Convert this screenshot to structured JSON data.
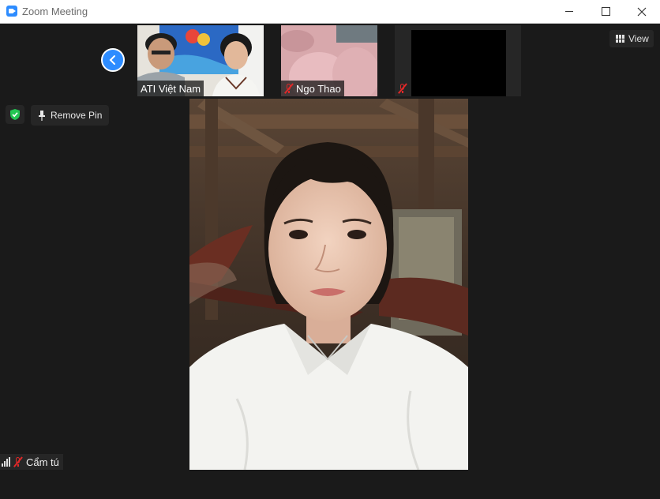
{
  "window": {
    "title": "Zoom Meeting"
  },
  "toolbar": {
    "view_label": "View",
    "remove_pin_label": "Remove Pin"
  },
  "thumbnails": [
    {
      "name": "ATI Việt Nam",
      "muted": false
    },
    {
      "name": "Ngo Thao",
      "muted": true
    },
    {
      "name": "",
      "muted": true
    }
  ],
  "self": {
    "name": "Cẩm tú",
    "muted": true
  },
  "colors": {
    "accent": "#2d8cff",
    "muted_red": "#e02828",
    "shield_green": "#23c552",
    "background": "#1a1a1a"
  }
}
